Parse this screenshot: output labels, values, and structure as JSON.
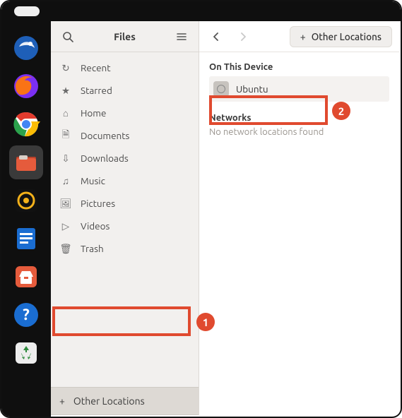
{
  "app": {
    "title": "Files"
  },
  "dock": {
    "items": [
      {
        "name": "thunderbird",
        "color": "#1e5fb8"
      },
      {
        "name": "firefox",
        "color": "#f97316"
      },
      {
        "name": "chrome",
        "color": "#fff"
      },
      {
        "name": "files",
        "color": "#e55b3c",
        "active": true
      },
      {
        "name": "rhythmbox",
        "color": "#111"
      },
      {
        "name": "libreoffice",
        "color": "#1a6dd1"
      },
      {
        "name": "software",
        "color": "#e55b3c"
      },
      {
        "name": "help",
        "color": "#1a6dd1"
      },
      {
        "name": "trash",
        "color": "#ededed"
      }
    ]
  },
  "sidebar": {
    "items": [
      {
        "icon": "clock-icon",
        "glyph": "↻",
        "label": "Recent"
      },
      {
        "icon": "star-icon",
        "glyph": "★",
        "label": "Starred"
      },
      {
        "icon": "home-icon",
        "glyph": "⌂",
        "label": "Home"
      },
      {
        "icon": "documents-icon",
        "glyph": "🗎",
        "label": "Documents"
      },
      {
        "icon": "downloads-icon",
        "glyph": "⇩",
        "label": "Downloads"
      },
      {
        "icon": "music-icon",
        "glyph": "♫",
        "label": "Music"
      },
      {
        "icon": "pictures-icon",
        "glyph": "🖼",
        "label": "Pictures"
      },
      {
        "icon": "videos-icon",
        "glyph": "▷",
        "label": "Videos"
      },
      {
        "icon": "trash-icon",
        "glyph": "🗑",
        "label": "Trash"
      }
    ],
    "other_label": "Other Locations"
  },
  "header": {
    "location_label": "Other Locations"
  },
  "content": {
    "device_section": "On This Device",
    "volume_name": "Ubuntu",
    "networks_section": "Networks",
    "networks_empty": "No network locations found"
  },
  "annotations": {
    "badge1": "1",
    "badge2": "2"
  }
}
